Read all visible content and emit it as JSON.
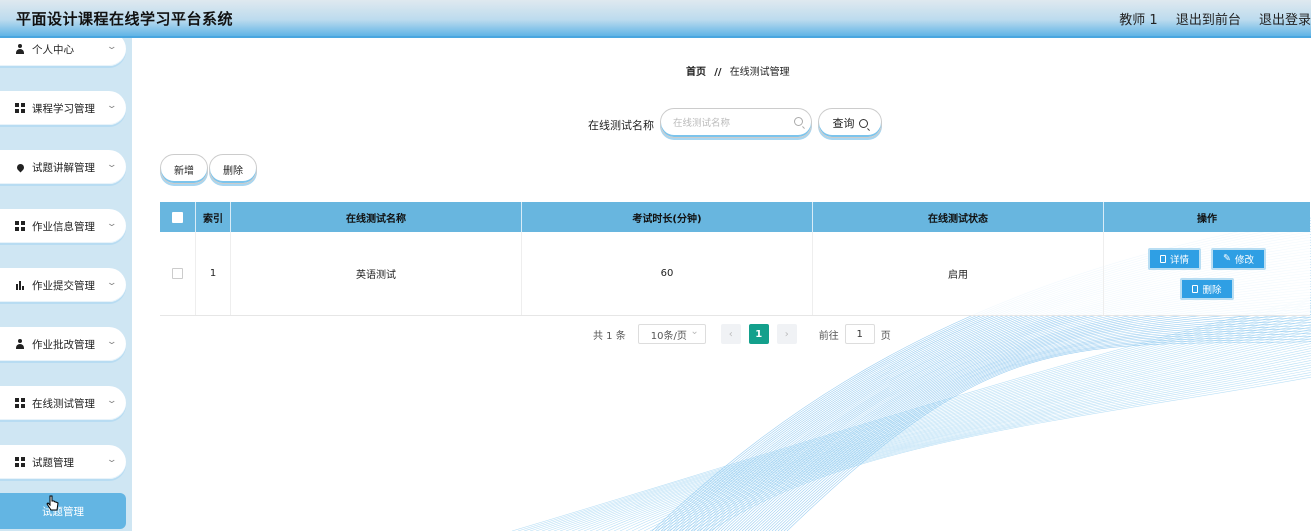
{
  "header": {
    "title": "平面设计课程在线学习平台系统",
    "user": "教师 1",
    "to_front": "退出到前台",
    "logout": "退出登录"
  },
  "sidebar": {
    "items": [
      {
        "label": "个人中心",
        "icon": "user-icon"
      },
      {
        "label": "课程学习管理",
        "icon": "grid-icon"
      },
      {
        "label": "试题讲解管理",
        "icon": "pin-icon"
      },
      {
        "label": "作业信息管理",
        "icon": "grid-icon"
      },
      {
        "label": "作业提交管理",
        "icon": "bar-chart-icon"
      },
      {
        "label": "作业批改管理",
        "icon": "user-icon"
      },
      {
        "label": "在线测试管理",
        "icon": "grid-icon"
      },
      {
        "label": "试题管理",
        "icon": "grid-icon"
      }
    ],
    "active_item": "试题管理"
  },
  "breadcrumb": {
    "home": "首页",
    "separator": "//",
    "current": "在线测试管理"
  },
  "search": {
    "label": "在线测试名称",
    "placeholder": "在线测试名称",
    "button": "查询"
  },
  "toolbar": {
    "add": "新增",
    "delete": "删除"
  },
  "table": {
    "columns": [
      "索引",
      "在线测试名称",
      "考试时长(分钟)",
      "在线测试状态",
      "操作"
    ],
    "rows": [
      {
        "index": "1",
        "name": "英语测试",
        "duration": "60",
        "status": "启用"
      }
    ],
    "actions": {
      "detail": "详情",
      "edit": "修改",
      "delete": "删除"
    }
  },
  "pagination": {
    "total": "共 1 条",
    "page_size": "10条/页",
    "prev": "‹",
    "current_page": "1",
    "next": "›",
    "goto_label": "前往",
    "goto_value": "1",
    "page_suffix": "页"
  },
  "colors": {
    "header_accent": "#49a6df",
    "table_header": "#68b6df",
    "action_button": "#2f9fe4",
    "pager_active": "#13a08c",
    "sidebar_bg": "#cfe6f3",
    "sidebar_active": "#63b5e3"
  }
}
